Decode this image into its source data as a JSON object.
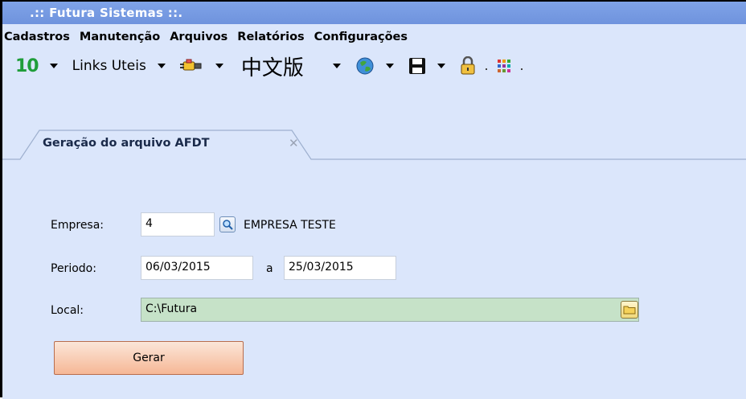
{
  "app": {
    "title": ".:: Futura Sistemas ::."
  },
  "menu": [
    "Cadastros",
    "Manutenção",
    "Arquivos",
    "Relatórios",
    "Configurações"
  ],
  "toolbar": {
    "version_icon_text": "10",
    "links_label": "Links Uteis",
    "language_label": "中文版"
  },
  "tab": {
    "title": "Geração do arquivo AFDT",
    "close": "✕"
  },
  "form": {
    "empresa_label": "Empresa:",
    "empresa_value": "4",
    "empresa_name": "EMPRESA TESTE",
    "periodo_label": "Periodo:",
    "periodo_start": "06/03/2015",
    "periodo_sep": "a",
    "periodo_end": "25/03/2015",
    "local_label": "Local:",
    "local_value": "C:\\Futura",
    "gerar_label": "Gerar"
  },
  "colors": {
    "titlebar": "#7fa3e8",
    "background": "#dbe6fb",
    "local_field": "#c6e2c8",
    "gerar_button": "#f6b796"
  }
}
